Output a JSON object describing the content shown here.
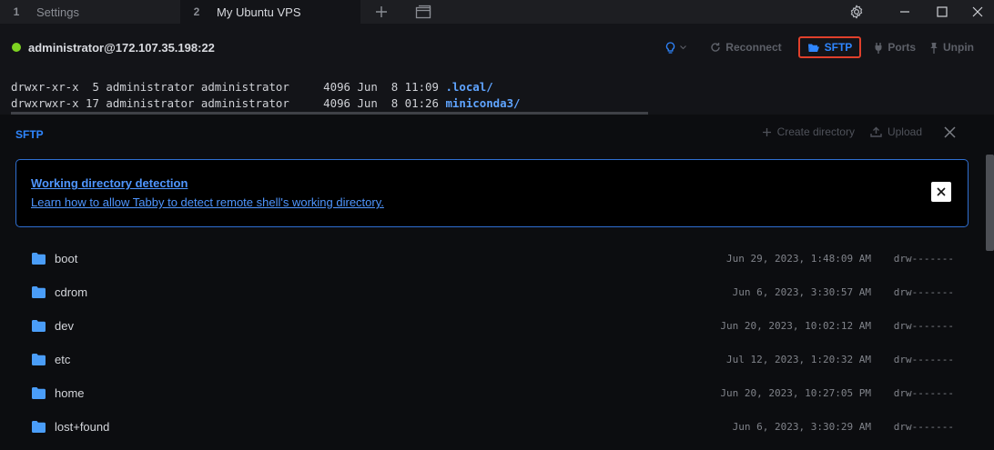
{
  "tabs": [
    {
      "num": "1",
      "label": "Settings"
    },
    {
      "num": "2",
      "label": "My Ubuntu VPS"
    }
  ],
  "terminal": {
    "host": "administrator@172.107.35.198:22",
    "actions": {
      "reconnect": "Reconnect",
      "sftp": "SFTP",
      "ports": "Ports",
      "unpin": "Unpin"
    },
    "lines": [
      {
        "prefix": "drwxr-xr-x  5 administrator administrator     4096 Jun  8 11:09 ",
        "name": ".local/"
      },
      {
        "prefix": "drwxrwxr-x 17 administrator administrator     4096 Jun  8 01:26 ",
        "name": "miniconda3/"
      }
    ]
  },
  "sftp": {
    "title": "SFTP",
    "create_directory": "Create directory",
    "upload": "Upload",
    "alert": {
      "title": "Working directory detection",
      "text": "Learn how to allow Tabby to detect remote shell's working directory."
    },
    "files": [
      {
        "name": "boot",
        "date": "Jun 29, 2023, 1:48:09 AM",
        "perm": "drw-------"
      },
      {
        "name": "cdrom",
        "date": "Jun 6, 2023, 3:30:57 AM",
        "perm": "drw-------"
      },
      {
        "name": "dev",
        "date": "Jun 20, 2023, 10:02:12 AM",
        "perm": "drw-------"
      },
      {
        "name": "etc",
        "date": "Jul 12, 2023, 1:20:32 AM",
        "perm": "drw-------"
      },
      {
        "name": "home",
        "date": "Jun 20, 2023, 10:27:05 PM",
        "perm": "drw-------"
      },
      {
        "name": "lost+found",
        "date": "Jun 6, 2023, 3:30:29 AM",
        "perm": "drw-------"
      }
    ]
  },
  "colors": {
    "accent": "#2f86ff",
    "highlight_border": "#e0402b",
    "status": "#7ed321"
  },
  "icons": [
    "plus-icon",
    "window-icon",
    "gear-icon",
    "minimize-icon",
    "maximize-icon",
    "close-icon",
    "bulb-icon",
    "reconnect-icon",
    "folder-open-icon",
    "plug-icon",
    "pin-icon",
    "upload-icon",
    "folder-icon"
  ]
}
